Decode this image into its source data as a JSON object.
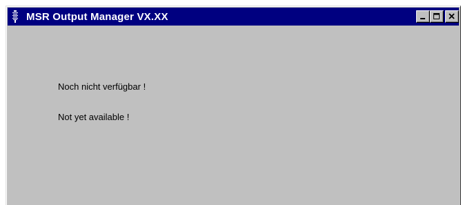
{
  "window": {
    "title": "MSR Output Manager VX.XX",
    "controls": {
      "minimize_icon": "minimize-icon",
      "maximize_icon": "maximize-icon",
      "close_icon": "close-icon"
    },
    "colors": {
      "titlebar": "#000080",
      "face": "#c0c0c0"
    }
  },
  "content": {
    "message_de": "Noch nicht verfügbar !",
    "message_en": "Not yet available !"
  }
}
